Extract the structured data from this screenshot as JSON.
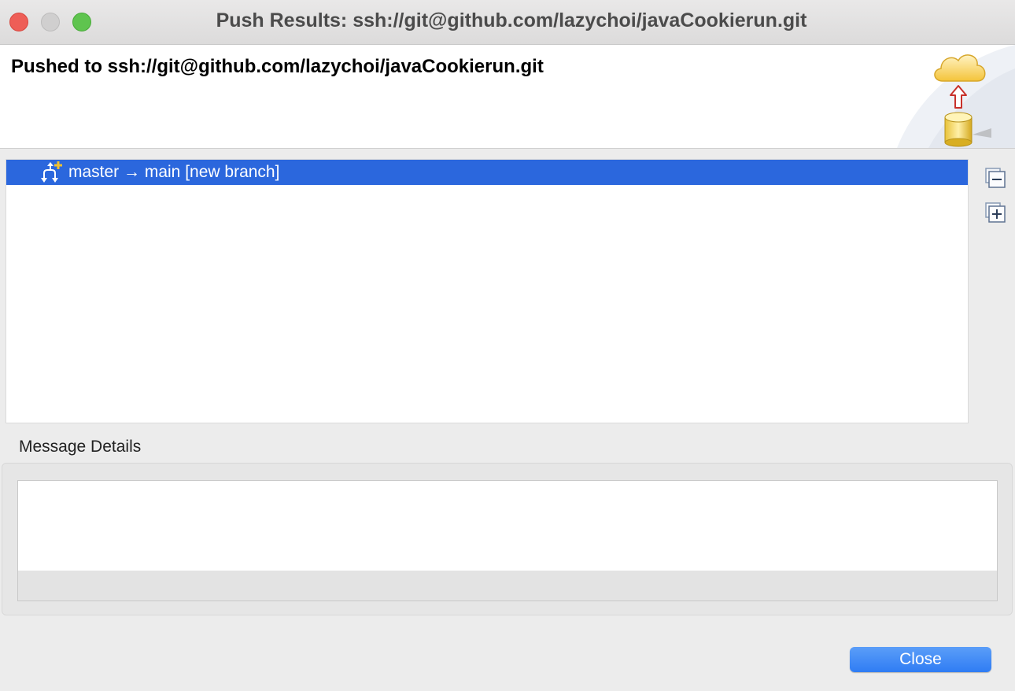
{
  "window": {
    "title": "Push Results: ssh://git@github.com/lazychoi/javaCookierun.git"
  },
  "banner": {
    "heading": "Pushed to ssh://git@github.com/lazychoi/javaCookierun.git",
    "image_icon": "push-to-cloud-icon"
  },
  "results": {
    "rows": [
      {
        "label": "master → main [new branch]",
        "icon": "new-branch-icon",
        "selected": true
      }
    ],
    "collapse_all_icon": "collapse-all-icon",
    "expand_all_icon": "expand-all-icon"
  },
  "details": {
    "label": "Message Details",
    "text": ""
  },
  "footer": {
    "close_label": "Close"
  },
  "colors": {
    "selection": "#2b67dd",
    "primary_button": "#2f7cf4"
  }
}
